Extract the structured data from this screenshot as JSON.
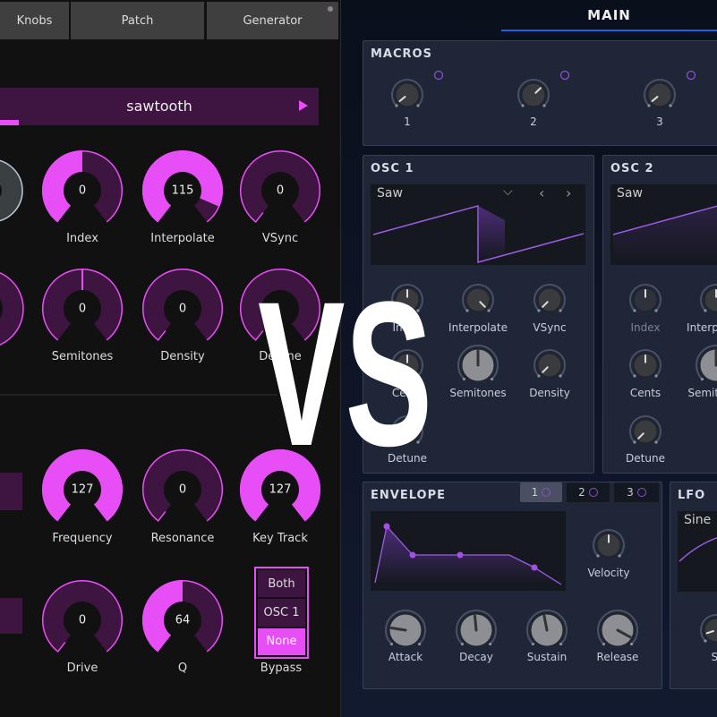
{
  "left": {
    "tabs": [
      "Knobs",
      "Patch",
      "Generator"
    ],
    "waveform_selector": {
      "value": "sawtooth",
      "progress": 0.06,
      "next_icon": "triangle-right-icon"
    },
    "knobs": [
      {
        "label": "Index",
        "value": "0",
        "fill": 0.5
      },
      {
        "label": "Interpolate",
        "value": "115",
        "fill": 0.9
      },
      {
        "label": "VSync",
        "value": "0",
        "fill": 0
      },
      {
        "label": "Semitones",
        "value": "0",
        "fill": 0.5,
        "bipolar": true
      },
      {
        "label": "Density",
        "value": "0",
        "fill": 0
      },
      {
        "label": "Detune",
        "value": "",
        "fill": 0
      },
      {
        "label": "Frequency",
        "value": "127",
        "fill": 1
      },
      {
        "label": "Resonance",
        "value": "0",
        "fill": 0
      },
      {
        "label": "Key Track",
        "value": "127",
        "fill": 1
      },
      {
        "label": "Drive",
        "value": "0",
        "fill": 0
      },
      {
        "label": "Q",
        "value": "64",
        "fill": 0.5
      }
    ],
    "bypass": {
      "label": "Bypass",
      "options": [
        "Both",
        "OSC 1",
        "None"
      ],
      "selected": "None"
    },
    "colors": {
      "accent": "#e84ef5",
      "track": "#3d1540"
    }
  },
  "overlay": {
    "text": "VS"
  },
  "right": {
    "tab": "MAIN",
    "macros": {
      "title": "MACROS",
      "knobs": [
        {
          "label": "1",
          "value": 0.02
        },
        {
          "label": "2",
          "value": 0.67
        },
        {
          "label": "3",
          "value": 0.02
        }
      ]
    },
    "osc1": {
      "title": "OSC 1",
      "waveform": "Saw",
      "knobs": [
        {
          "label": "Index",
          "value": 0.5
        },
        {
          "label": "Interpolate",
          "value": 1.0
        },
        {
          "label": "VSync",
          "value": 0
        },
        {
          "label": "Cents",
          "value": 0.5
        },
        {
          "label": "Semitones",
          "value": 0.5
        },
        {
          "label": "Density",
          "value": 0
        },
        {
          "label": "Detune",
          "value": 0
        }
      ]
    },
    "osc2": {
      "title": "OSC 2",
      "waveform": "Saw",
      "knobs": [
        {
          "label": "Index",
          "value": 0.5
        },
        {
          "label": "Interpolate",
          "value": 0.5
        },
        {
          "label": "Cents",
          "value": 0.5
        },
        {
          "label": "Semitones",
          "value": 0.5
        },
        {
          "label": "Detune",
          "value": 0
        }
      ]
    },
    "envelope": {
      "title": "ENVELOPE",
      "tabs": [
        "1",
        "2",
        "3"
      ],
      "active_tab": "1",
      "knobs": [
        {
          "label": "Velocity",
          "value": 0.5
        },
        {
          "label": "Attack",
          "value": 0.2
        },
        {
          "label": "Decay",
          "value": 0.48
        },
        {
          "label": "Sustain",
          "value": 0.46
        },
        {
          "label": "Release",
          "value": 0.94
        }
      ]
    },
    "lfo": {
      "title": "LFO",
      "waveform": "Sine",
      "knobs": [
        {
          "label": "Sl",
          "value": 0.1
        }
      ]
    },
    "colors": {
      "accent": "#9b5de5",
      "tab_underline": "#1f5fe0"
    }
  }
}
